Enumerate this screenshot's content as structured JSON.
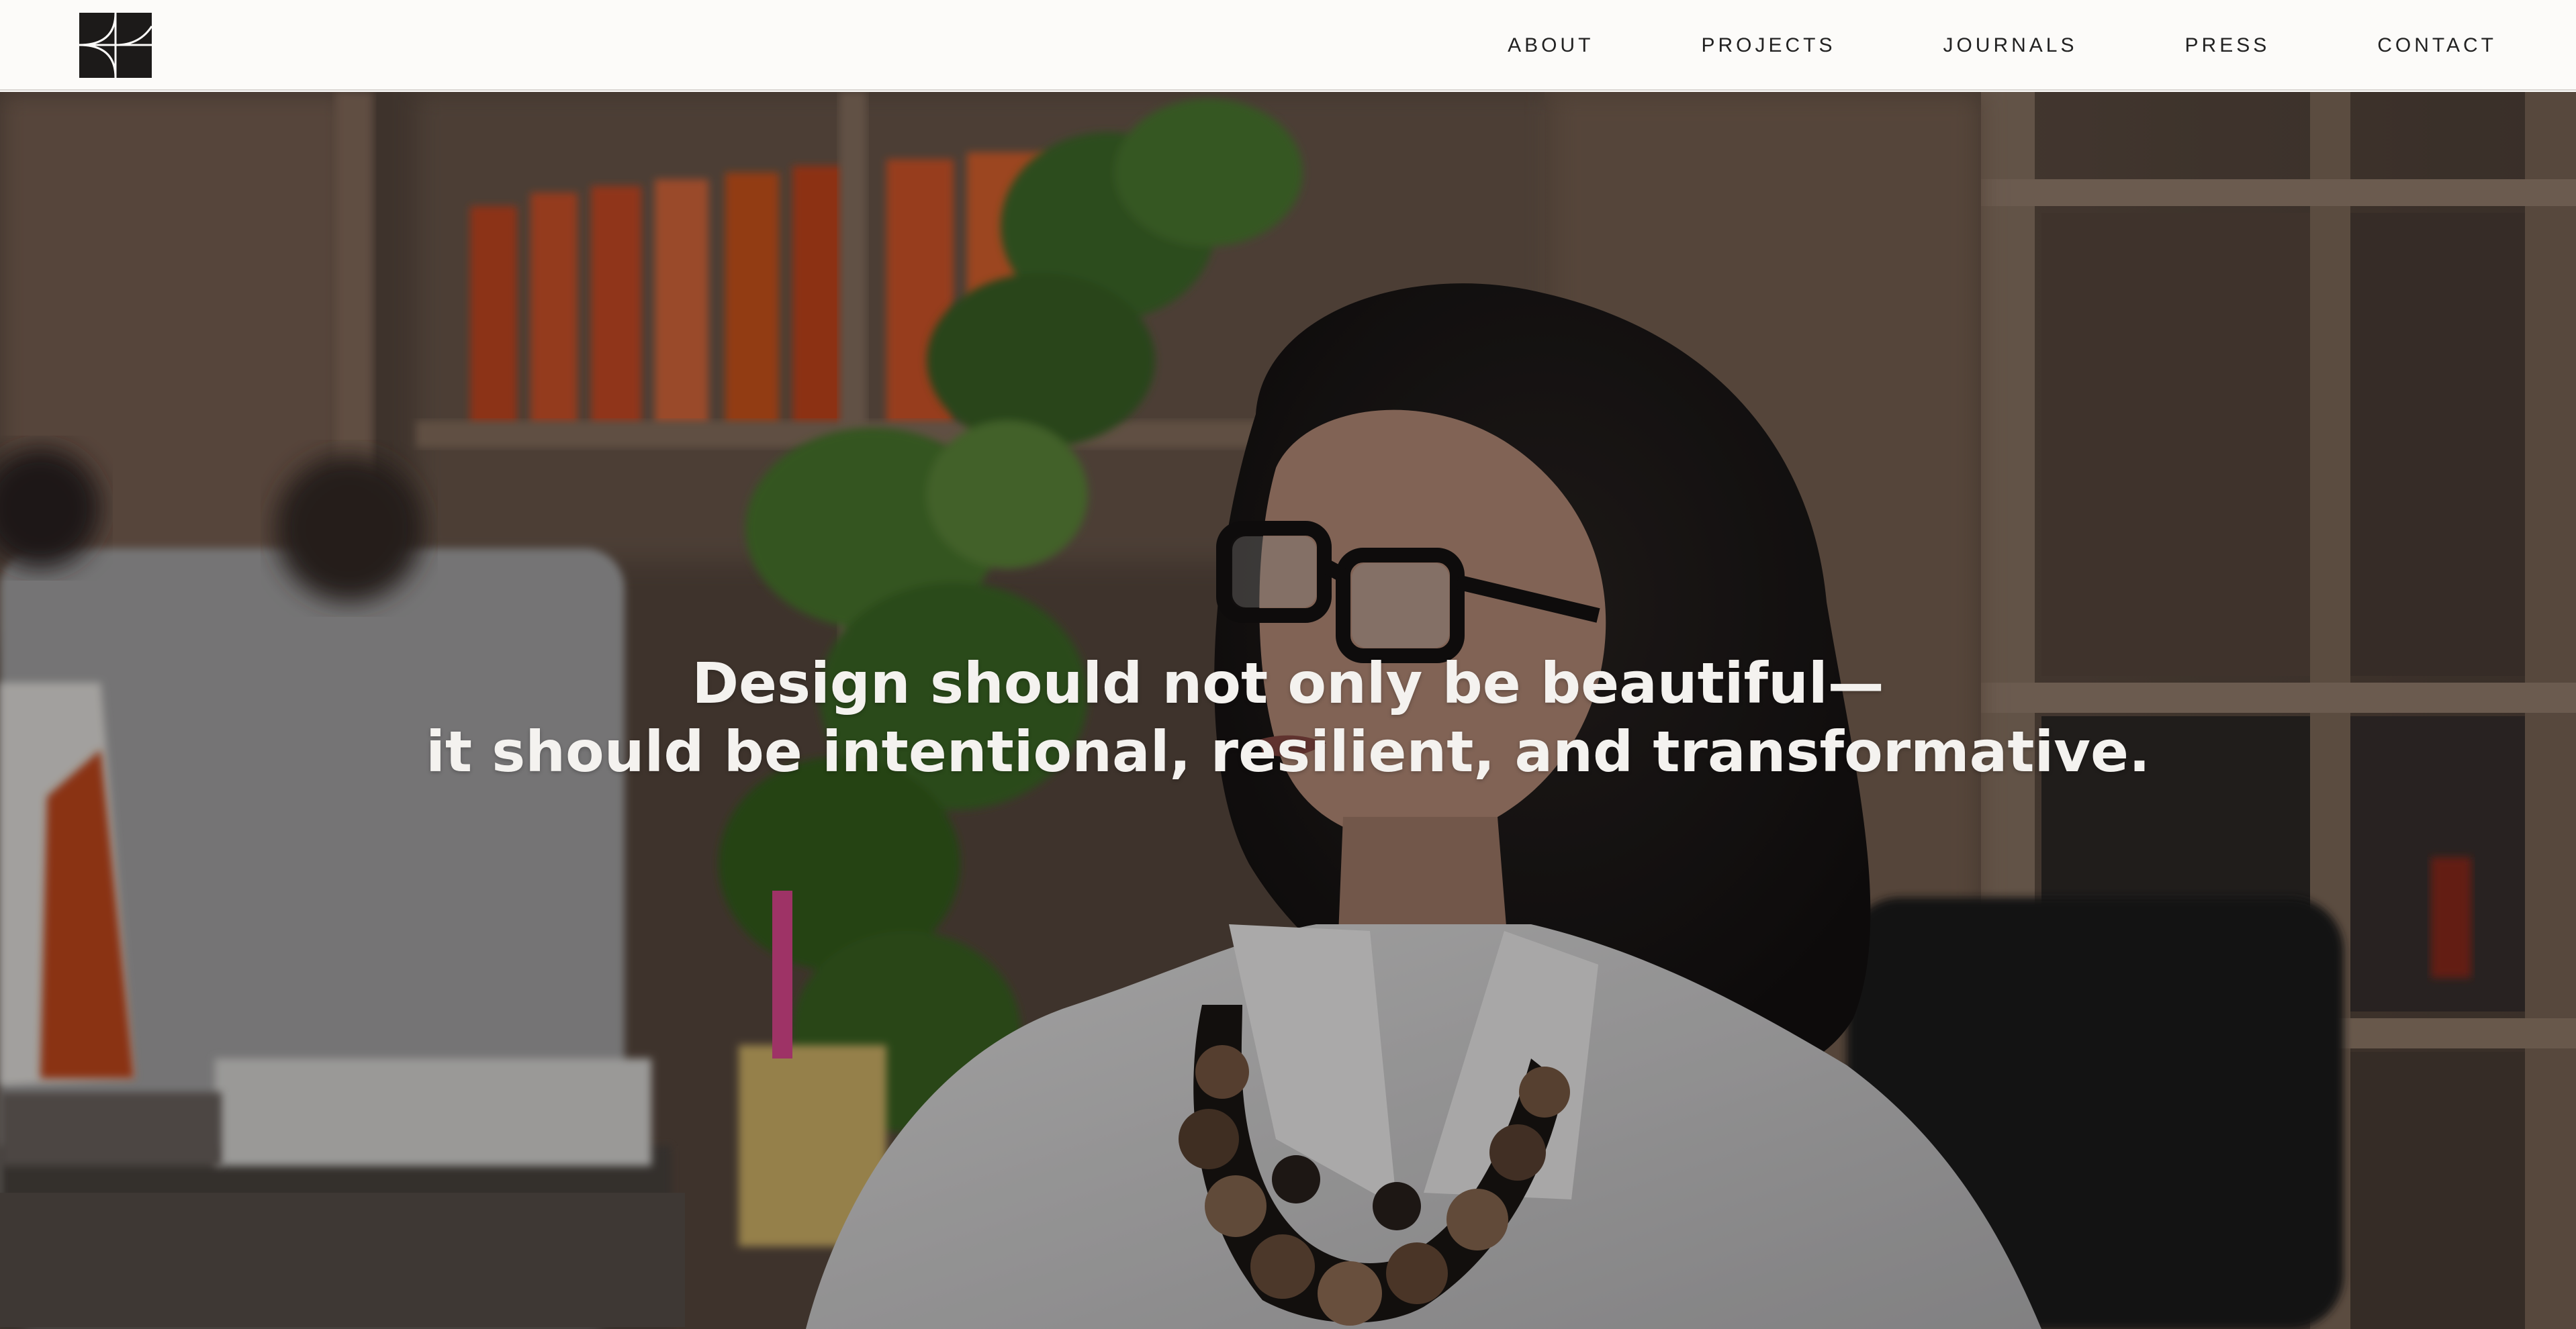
{
  "header": {
    "logo": {
      "icon": "studio-monogram-logo"
    },
    "nav": [
      {
        "id": "about",
        "label": "ABOUT"
      },
      {
        "id": "projects",
        "label": "PROJECTS"
      },
      {
        "id": "journals",
        "label": "JOURNALS"
      },
      {
        "id": "press",
        "label": "PRESS"
      },
      {
        "id": "contact",
        "label": "CONTACT"
      }
    ]
  },
  "hero": {
    "quote_line1": "Design should not only be beautiful—",
    "quote_line2": "it should be intentional, resilient, and transformative.",
    "background": "video-still-woman-in-studio"
  },
  "colors": {
    "header_bg": "#fcfbf9",
    "nav_text": "#222222",
    "quote_text": "#f4f2ef",
    "accent_orange": "#d2521f"
  }
}
